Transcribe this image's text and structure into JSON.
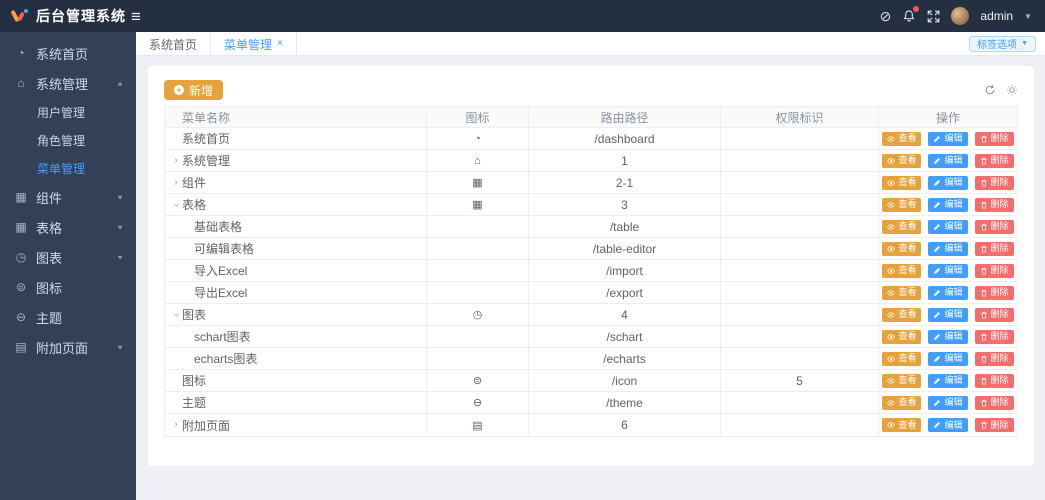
{
  "header": {
    "logo_title": "后台管理系统",
    "user": "admin",
    "icons": [
      "language-icon",
      "bell-icon",
      "fullscreen-icon"
    ],
    "bell_has_badge": true
  },
  "sidebar": {
    "items": [
      {
        "key": "home",
        "label": "系统首页",
        "icon": "dashboard"
      },
      {
        "key": "system",
        "label": "系统管理",
        "icon": "home",
        "state": "expanded",
        "children": [
          {
            "key": "users",
            "label": "用户管理",
            "active": false
          },
          {
            "key": "roles",
            "label": "角色管理",
            "active": false
          },
          {
            "key": "menus",
            "label": "菜单管理",
            "active": true
          }
        ]
      },
      {
        "key": "components",
        "label": "组件",
        "icon": "component",
        "state": "collapsed"
      },
      {
        "key": "tables",
        "label": "表格",
        "icon": "table",
        "state": "collapsed"
      },
      {
        "key": "charts",
        "label": "图表",
        "icon": "chart",
        "state": "collapsed"
      },
      {
        "key": "icons",
        "label": "图标",
        "icon": "icon"
      },
      {
        "key": "theme",
        "label": "主题",
        "icon": "theme"
      },
      {
        "key": "pages",
        "label": "附加页面",
        "icon": "page",
        "state": "collapsed"
      }
    ]
  },
  "tabs": {
    "items": [
      {
        "key": "home",
        "label": "系统首页",
        "active": false,
        "closable": false
      },
      {
        "key": "menus",
        "label": "菜单管理",
        "active": true,
        "closable": true
      }
    ],
    "close_glyph": "×",
    "options_button": "标签选项"
  },
  "toolbar": {
    "add_label": "新增",
    "icons": [
      "refresh-icon",
      "settings-icon"
    ]
  },
  "table": {
    "columns": [
      "菜单名称",
      "图标",
      "路由路径",
      "权限标识",
      "操作"
    ],
    "action_labels": {
      "view": "查看",
      "edit": "编辑",
      "delete": "删除"
    },
    "rows": [
      {
        "name": "系统首页",
        "level": 1,
        "arrow": "",
        "icon": "dashboard",
        "route": "/dashboard",
        "perm": ""
      },
      {
        "name": "系统管理",
        "level": 1,
        "arrow": "collapsed",
        "icon": "home",
        "route": "1",
        "perm": ""
      },
      {
        "name": "组件",
        "level": 1,
        "arrow": "collapsed",
        "icon": "calendar",
        "route": "2-1",
        "perm": ""
      },
      {
        "name": "表格",
        "level": 1,
        "arrow": "expanded",
        "icon": "calendar",
        "route": "3",
        "perm": ""
      },
      {
        "name": "基础表格",
        "level": 2,
        "arrow": "",
        "icon": "",
        "route": "/table",
        "perm": ""
      },
      {
        "name": "可编辑表格",
        "level": 2,
        "arrow": "",
        "icon": "",
        "route": "/table-editor",
        "perm": ""
      },
      {
        "name": "导入Excel",
        "level": 2,
        "arrow": "",
        "icon": "",
        "route": "/import",
        "perm": ""
      },
      {
        "name": "导出Excel",
        "level": 2,
        "arrow": "",
        "icon": "",
        "route": "/export",
        "perm": ""
      },
      {
        "name": "图表",
        "level": 1,
        "arrow": "expanded",
        "icon": "clock",
        "route": "4",
        "perm": ""
      },
      {
        "name": "schart图表",
        "level": 2,
        "arrow": "",
        "icon": "",
        "route": "/schart",
        "perm": ""
      },
      {
        "name": "echarts图表",
        "level": 2,
        "arrow": "",
        "icon": "",
        "route": "/echarts",
        "perm": ""
      },
      {
        "name": "图标",
        "level": 1,
        "arrow": "",
        "icon": "icon",
        "route": "/icon",
        "perm": "5"
      },
      {
        "name": "主题",
        "level": 1,
        "arrow": "",
        "icon": "theme",
        "route": "/theme",
        "perm": ""
      },
      {
        "name": "附加页面",
        "level": 1,
        "arrow": "collapsed",
        "icon": "page",
        "route": "6",
        "perm": ""
      }
    ]
  },
  "colors": {
    "topbar_bg": "#242f42",
    "sidebar_bg": "#324157",
    "primary": "#409eff",
    "warning": "#e6a23c",
    "danger": "#f56c6c",
    "active_menu_text": "#409eff"
  }
}
